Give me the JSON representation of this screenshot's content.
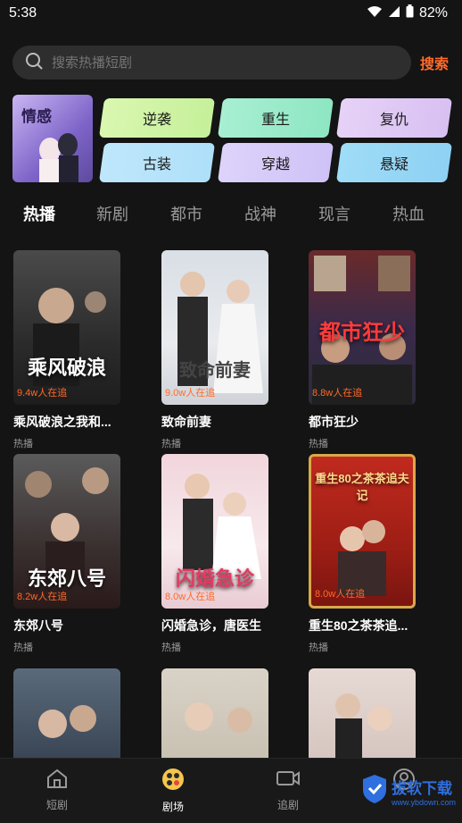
{
  "status": {
    "time": "5:38",
    "battery": "82%"
  },
  "search": {
    "placeholder": "搜索热播短剧",
    "button": "搜索"
  },
  "genres": {
    "featured": "情感",
    "items": [
      "逆袭",
      "重生",
      "复仇",
      "古装",
      "穿越",
      "悬疑"
    ]
  },
  "tabs": [
    "热播",
    "新剧",
    "都市",
    "战神",
    "现言",
    "热血"
  ],
  "cards": [
    {
      "title": "乘风破浪之我和...",
      "tag": "热播",
      "count": "9.4w人在追",
      "poster_text": "乘风破浪"
    },
    {
      "title": "致命前妻",
      "tag": "热播",
      "count": "9.0w人在追",
      "poster_text": "致命前妻"
    },
    {
      "title": "都市狂少",
      "tag": "热播",
      "count": "8.8w人在追",
      "poster_text": "都市狂少"
    },
    {
      "title": "东郊八号",
      "tag": "热播",
      "count": "8.2w人在追",
      "poster_text": "东郊八号"
    },
    {
      "title": "闪婚急诊，唐医生",
      "tag": "热播",
      "count": "8.0w人在追",
      "poster_text": "闪婚急诊"
    },
    {
      "title": "重生80之茶茶追...",
      "tag": "热播",
      "count": "8.0w人在追",
      "poster_text": "重生80之茶茶追夫记"
    },
    {
      "title": "",
      "tag": "",
      "count": "",
      "poster_text": ""
    },
    {
      "title": "",
      "tag": "",
      "count": "",
      "poster_text": ""
    },
    {
      "title": "",
      "tag": "",
      "count": "",
      "poster_text": ""
    }
  ],
  "nav": [
    "短剧",
    "剧场",
    "追剧",
    ""
  ],
  "watermark": {
    "main": "拔软下载",
    "sub": "www.ybdown.com"
  }
}
